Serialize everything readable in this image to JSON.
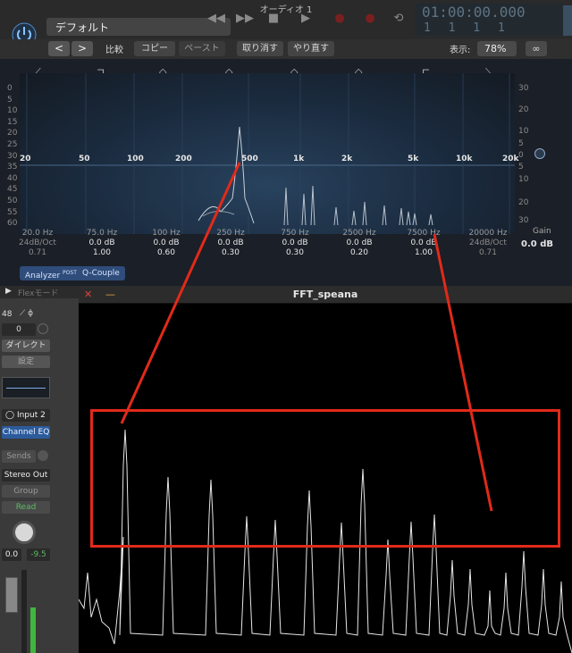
{
  "header": {
    "window_title": "オーディオ 1",
    "preset": "デフォルト",
    "lcd_time": "01:00:00.000",
    "lcd_bars": "1 1 1 1"
  },
  "toolbar": {
    "back": "<",
    "forward": ">",
    "compare": "比較",
    "copy": "コピー",
    "paste": "ペースト",
    "undo": "取り消す",
    "redo": "やり直す",
    "view_label": "表示:",
    "zoom": "78%"
  },
  "eq": {
    "db_scale_left": [
      "0",
      "5",
      "10",
      "15",
      "20",
      "25",
      "30",
      "35",
      "40",
      "45",
      "50",
      "55",
      "60"
    ],
    "db_scale_right": [
      "30",
      "20",
      "10",
      "5",
      "0",
      "5",
      "10",
      "20",
      "30"
    ],
    "freq_labels": [
      "20",
      "50",
      "100",
      "200",
      "500",
      "1k",
      "2k",
      "5k",
      "10k",
      "20k"
    ],
    "bands": [
      {
        "freq": "20.0 Hz",
        "gain": "24dB/Oct",
        "q": "0.71"
      },
      {
        "freq": "75.0 Hz",
        "gain": "0.0 dB",
        "q": "1.00"
      },
      {
        "freq": "100 Hz",
        "gain": "0.0 dB",
        "q": "0.60"
      },
      {
        "freq": "250 Hz",
        "gain": "0.0 dB",
        "q": "0.30"
      },
      {
        "freq": "750 Hz",
        "gain": "0.0 dB",
        "q": "0.30"
      },
      {
        "freq": "2500 Hz",
        "gain": "0.0 dB",
        "q": "0.20"
      },
      {
        "freq": "7500 Hz",
        "gain": "0.0 dB",
        "q": "1.00"
      },
      {
        "freq": "20000 Hz",
        "gain": "24dB/Oct",
        "q": "0.71"
      }
    ],
    "gain_label": "Gain",
    "gain_value": "0.0 dB",
    "analyzer": "Analyzer",
    "analyzer_badge": "POST",
    "q_couple": "Q-Couple"
  },
  "strip": {
    "flex_label": "Flexモード",
    "value_48": "48",
    "value_0": "0",
    "direct": "ダイレクト",
    "settings": "設定",
    "input": "Input 2",
    "insert": "Channel EQ",
    "sends": "Sends",
    "output": "Stereo Out",
    "group": "Group",
    "automation": "Read",
    "vol": "0.0",
    "peak": "-9.5"
  },
  "fft": {
    "title": "FFT_speana"
  },
  "colors": {
    "accent_red": "#e12a1a",
    "eq_blue": "#2f4c7a",
    "read_green": "#5dbb63"
  }
}
